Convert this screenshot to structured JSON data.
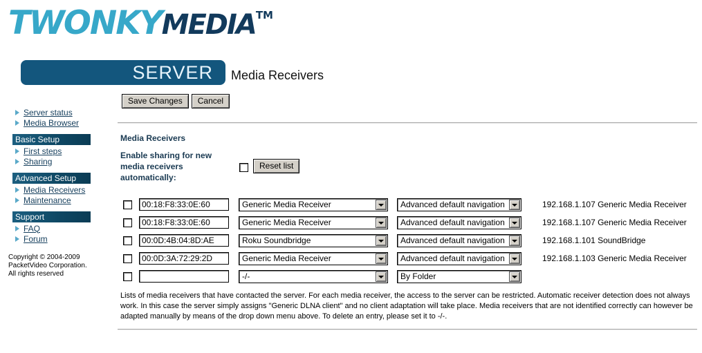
{
  "brand": {
    "name_part1": "TWONKY",
    "name_part2": "MEDIA",
    "trademark": "TM",
    "server_word": "SERVER",
    "color_light": "#37a8c9",
    "color_dark": "#123a5c",
    "banner_color": "#13567d"
  },
  "header": {
    "page_title": "Media Receivers"
  },
  "toolbar": {
    "save_label": "Save Changes",
    "cancel_label": "Cancel"
  },
  "sidebar": {
    "groups": [
      {
        "heading": null,
        "items": [
          {
            "label": "Server status",
            "active": false
          },
          {
            "label": "Media Browser",
            "active": false
          }
        ]
      },
      {
        "heading": "Basic Setup",
        "items": [
          {
            "label": "First steps",
            "active": false
          },
          {
            "label": "Sharing",
            "active": false
          }
        ]
      },
      {
        "heading": "Advanced Setup",
        "items": [
          {
            "label": "Media Receivers",
            "active": true
          },
          {
            "label": "Maintenance",
            "active": false
          }
        ]
      },
      {
        "heading": "Support",
        "items": [
          {
            "label": "FAQ",
            "active": false
          },
          {
            "label": "Forum",
            "active": false
          }
        ]
      }
    ],
    "copyright_line1": "Copyright © 2004-2009",
    "copyright_line2": "PacketVideo Corporation.",
    "copyright_line3": "All rights reserved"
  },
  "main": {
    "section_title": "Media Receivers",
    "enable_label": "Enable sharing for new media receivers automatically:",
    "enable_checked": false,
    "reset_label": "Reset list",
    "rows": [
      {
        "checked": false,
        "mac": "00:18:F8:33:0E:60",
        "type": "Generic Media Receiver",
        "navigation": "Advanced default navigation",
        "ip_info": "192.168.1.107 Generic Media Receiver"
      },
      {
        "checked": false,
        "mac": "00:18:F8:33:0E:60",
        "type": "Generic Media Receiver",
        "navigation": "Advanced default navigation",
        "ip_info": "192.168.1.107 Generic Media Receiver"
      },
      {
        "checked": false,
        "mac": "00:0D:4B:04:8D:AE",
        "type": "Roku Soundbridge",
        "navigation": "Advanced default navigation",
        "ip_info": "192.168.1.101 SoundBridge"
      },
      {
        "checked": false,
        "mac": "00:0D:3A:72:29:2D",
        "type": "Generic Media Receiver",
        "navigation": "Advanced default navigation",
        "ip_info": "192.168.1.103 Generic Media Receiver"
      },
      {
        "checked": false,
        "mac": "",
        "type": "-/-",
        "navigation": "By Folder",
        "ip_info": ""
      }
    ],
    "description": "Lists of media receivers that have contacted the server. For each media receiver, the access to the server can be restricted. Automatic receiver detection does not always work. In this case the server simply assigns \"Generic DLNA client\" and no client adaptation will take place. Media receivers that are not identified correctly can however be adapted manually by means of the drop down menu above. To delete an entry, please set it to -/-."
  }
}
